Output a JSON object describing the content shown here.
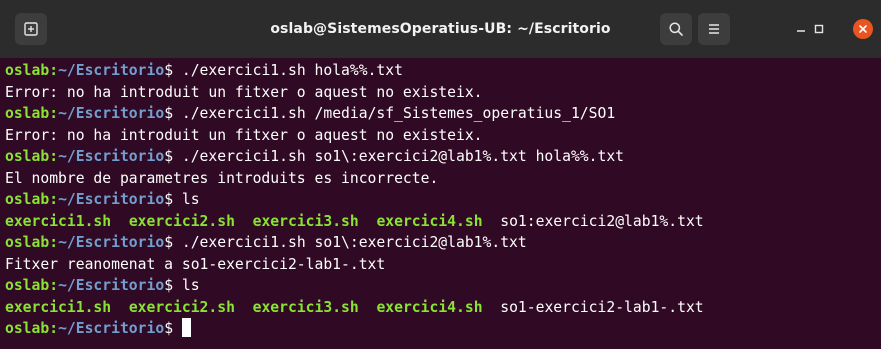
{
  "window": {
    "title": "oslab@SistemesOperatius-UB: ~/Escritorio"
  },
  "titlebar": {
    "icons": [
      "new-tab-icon",
      "search-icon",
      "menu-icon",
      "minimize-icon",
      "maximize-icon",
      "close-icon"
    ]
  },
  "colors": {
    "terminal_bg": "#300a24",
    "titlebar_bg": "#2c2c2c",
    "prompt_user": "#8ae234",
    "prompt_path": "#729fcf",
    "executable": "#8ae234",
    "close_button": "#e95420"
  },
  "prompt": {
    "user": "oslab",
    "sep": ":",
    "path": "~/Escritorio",
    "symbol": "$ "
  },
  "terminal": {
    "lines": [
      {
        "kind": "prompt",
        "command": "./exercici1.sh hola%%.txt"
      },
      {
        "kind": "output",
        "text": "Error: no ha introduit un fitxer o aquest no existeix."
      },
      {
        "kind": "prompt",
        "command": "./exercici1.sh /media/sf_Sistemes_operatius_1/SO1"
      },
      {
        "kind": "output",
        "text": "Error: no ha introduit un fitxer o aquest no existeix."
      },
      {
        "kind": "prompt",
        "command": "./exercici1.sh so1\\:exercici2@lab1%.txt hola%%.txt"
      },
      {
        "kind": "output",
        "text": "El nombre de parametres introduits es incorrecte."
      },
      {
        "kind": "prompt",
        "command": "ls"
      },
      {
        "kind": "ls",
        "items": [
          {
            "name": "exercici1.sh",
            "exec": true
          },
          {
            "name": "exercici2.sh",
            "exec": true
          },
          {
            "name": "exercici3.sh",
            "exec": true
          },
          {
            "name": "exercici4.sh",
            "exec": true
          },
          {
            "name": "so1:exercici2@lab1%.txt",
            "exec": false
          }
        ]
      },
      {
        "kind": "prompt",
        "command": "./exercici1.sh so1\\:exercici2@lab1%.txt"
      },
      {
        "kind": "output",
        "text": "Fitxer reanomenat a so1-exercici2-lab1-.txt"
      },
      {
        "kind": "prompt",
        "command": "ls"
      },
      {
        "kind": "ls",
        "items": [
          {
            "name": "exercici1.sh",
            "exec": true
          },
          {
            "name": "exercici2.sh",
            "exec": true
          },
          {
            "name": "exercici3.sh",
            "exec": true
          },
          {
            "name": "exercici4.sh",
            "exec": true
          },
          {
            "name": "so1-exercici2-lab1-.txt",
            "exec": false
          }
        ]
      },
      {
        "kind": "prompt",
        "command": "",
        "cursor": true
      }
    ]
  }
}
